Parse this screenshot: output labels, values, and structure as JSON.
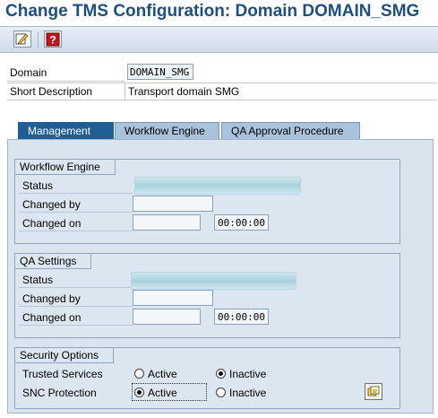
{
  "title": "Change TMS Configuration: Domain DOMAIN_SMG",
  "toolbar": {
    "icons": [
      "display-change-icon",
      "help-icon"
    ]
  },
  "header_fields": {
    "domain_label": "Domain",
    "domain_value": "DOMAIN_SMG",
    "short_desc_label": "Short Description",
    "short_desc_value": "Transport domain SMG"
  },
  "tabs": [
    {
      "label": "Management",
      "active": true
    },
    {
      "label": "Workflow Engine",
      "active": false
    },
    {
      "label": "QA Approval Procedure",
      "active": false
    }
  ],
  "workflow_engine": {
    "title": "Workflow Engine",
    "status_label": "Status",
    "changed_by_label": "Changed by",
    "changed_by_value": "",
    "changed_on_label": "Changed on",
    "changed_on_date": "",
    "changed_on_time": "00:00:00"
  },
  "qa_settings": {
    "title": "QA Settings",
    "status_label": "Status",
    "changed_by_label": "Changed by",
    "changed_by_value": "",
    "changed_on_label": "Changed on",
    "changed_on_date": "",
    "changed_on_time": "00:00:00"
  },
  "security_options": {
    "title": "Security Options",
    "trusted_services_label": "Trusted Services",
    "trusted_services_active": "Active",
    "trusted_services_inactive": "Inactive",
    "trusted_services_selected": "Inactive",
    "snc_label": "SNC Protection",
    "snc_active": "Active",
    "snc_inactive": "Inactive",
    "snc_selected": "Active"
  },
  "colors": {
    "title": "#1f4f7a",
    "active_tab": "#1f5f96",
    "panel": "#d9e4ef"
  }
}
